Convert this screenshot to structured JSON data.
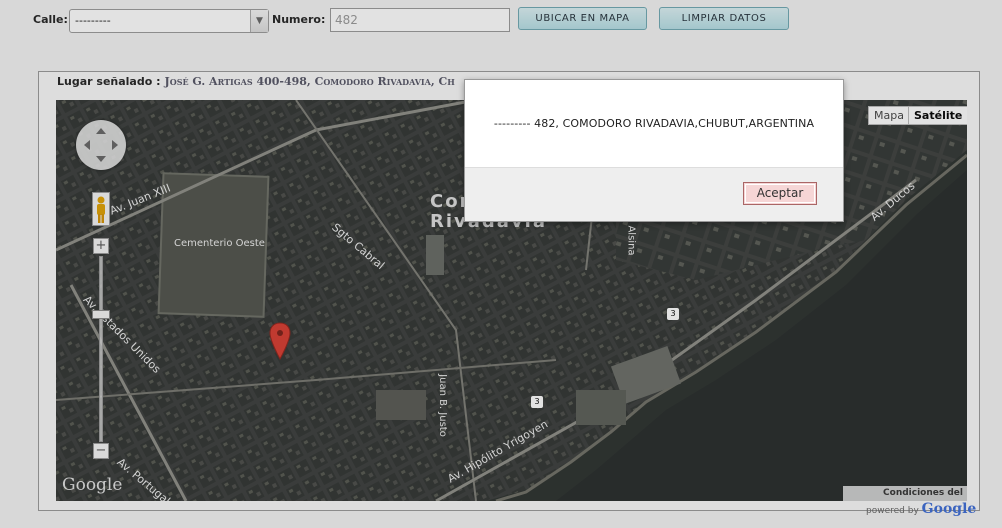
{
  "form": {
    "calle_label": "Calle:",
    "calle_value": "---------",
    "numero_label": "Numero:",
    "numero_value": "482",
    "ubicar_button": "UBICAR EN MAPA",
    "limpiar_button": "LIMPIAR DATOS"
  },
  "panel": {
    "lugar_label": "Lugar señalado :",
    "lugar_value": "José G. Artigas 400-498, Comodoro Rivadavia, Ch"
  },
  "map": {
    "type_buttons": [
      "Mapa",
      "Satélite"
    ],
    "active_type": "Satélite",
    "street_labels": [
      "Av. Juan XIII",
      "Cementerio Oeste",
      "Sgto Cabral",
      "Av. Estados Unidos",
      "Juan B. Justo",
      "Av. Hipólito Yrigoyen",
      "Av. Ducos",
      "Av. Portugal",
      "Comodoro Rivadavia",
      "Alsina"
    ],
    "route_markers": [
      "3",
      "3"
    ],
    "google_logo": "Google",
    "terms": "Condiciones del servicio",
    "powered_by": "powered by",
    "powered_brand": "Google"
  },
  "dialog": {
    "message": "--------- 482, COMODORO RIVADAVIA,CHUBUT,ARGENTINA",
    "ok_button": "Aceptar"
  }
}
